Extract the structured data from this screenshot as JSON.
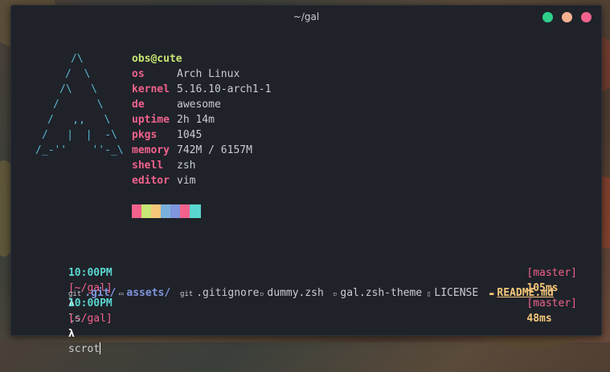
{
  "window": {
    "title": "~/gal",
    "buttons": [
      {
        "name": "maximize",
        "color": "#2fcf8a"
      },
      {
        "name": "minimize",
        "color": "#f5b090"
      },
      {
        "name": "close",
        "color": "#f2628c"
      }
    ]
  },
  "fetch": {
    "ascii_logo": [
      "/\\",
      "/  \\",
      "/\\   \\",
      "/      \\",
      "/   ,,   \\",
      "/   |  |  -\\",
      "/_-''    ''-_\\"
    ],
    "user_host": "obs@cute",
    "info": [
      {
        "label": "os",
        "value": "Arch Linux"
      },
      {
        "label": "kernel",
        "value": "5.16.10-arch1-1"
      },
      {
        "label": "de",
        "value": "awesome"
      },
      {
        "label": "uptime",
        "value": "2h 14m"
      },
      {
        "label": "pkgs",
        "value": "1045"
      },
      {
        "label": "memory",
        "value": "742M / 6157M"
      },
      {
        "label": "shell",
        "value": "zsh"
      },
      {
        "label": "editor",
        "value": "vim"
      }
    ],
    "palette": [
      "#f2628c",
      "#c8e673",
      "#f5c77a",
      "#7ab0dc",
      "#7f95dc",
      "#f2628c",
      "#5ad6d0"
    ]
  },
  "prompts": [
    {
      "time": "10:00PM",
      "dir": "[~/gal]",
      "lambda": "λ",
      "command": "ls",
      "branch": "[master]",
      "duration": "105ms"
    },
    {
      "time": "10:00PM",
      "dir": "[~/gal]",
      "lambda": "λ",
      "command": "scrot",
      "branch": "[master]",
      "duration": "48ms"
    }
  ],
  "ls_output": [
    {
      "icon": "git",
      "name": ".git/",
      "type": "git-dir"
    },
    {
      "icon": "folder",
      "name": "assets/",
      "type": "dir"
    },
    {
      "icon": "git",
      "name": ".gitignore",
      "type": "file"
    },
    {
      "icon": "file",
      "name": "dummy.zsh",
      "type": "file"
    },
    {
      "icon": "file",
      "name": "gal.zsh-theme",
      "type": "file"
    },
    {
      "icon": "doc",
      "name": "LICENSE",
      "type": "file"
    },
    {
      "icon": "markdown",
      "name": "README.md",
      "type": "readme"
    }
  ],
  "ls_icons": {
    "git": "git",
    "folder": "▭",
    "file": "▫",
    "doc": "▯",
    "markdown": "▬"
  }
}
